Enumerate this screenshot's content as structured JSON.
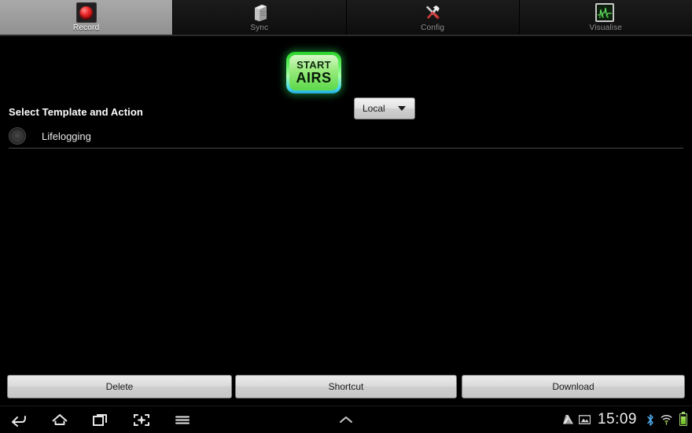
{
  "tabs": [
    {
      "label": "Record",
      "icon": "record-dot-icon",
      "active": true
    },
    {
      "label": "Sync",
      "icon": "server-box-icon",
      "active": false
    },
    {
      "label": "Config",
      "icon": "tools-icon",
      "active": false
    },
    {
      "label": "Visualise",
      "icon": "graph-frame-icon",
      "active": false
    }
  ],
  "action": {
    "start_line1": "START",
    "start_line2": "AIRS",
    "spinner_value": "Local",
    "spinner_caret_icon": "chevron-down-icon"
  },
  "section": {
    "title": "Select Template and Action",
    "templates": [
      {
        "label": "Lifelogging",
        "selected": false
      }
    ]
  },
  "buttons": {
    "delete": "Delete",
    "shortcut": "Shortcut",
    "download": "Download"
  },
  "navbar": {
    "back_icon": "back-arrow-icon",
    "home_icon": "home-icon",
    "recents_icon": "recent-apps-icon",
    "screenshot_icon": "screen-capture-icon",
    "menu_icon": "menu-hamburger-icon",
    "expand_icon": "chevron-up-icon",
    "status": {
      "drive_icon": "google-drive-icon",
      "gallery_icon": "gallery-image-icon",
      "time": "15:09",
      "bluetooth_icon": "bluetooth-icon",
      "wifi_icon": "wifi-icon",
      "battery_icon": "battery-icon"
    }
  },
  "colors": {
    "accent_green": "#5bd84a",
    "accent_cyan": "#23a8d8",
    "record_red": "#ee2b2b",
    "battery_green": "#9fd06b"
  }
}
